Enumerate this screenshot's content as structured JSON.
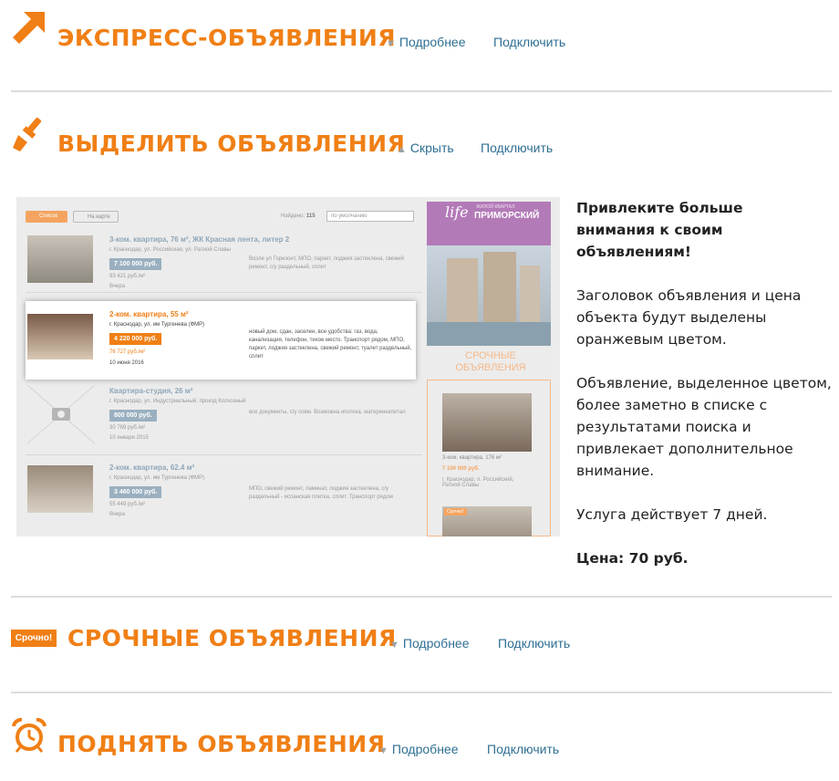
{
  "sections": [
    {
      "title": "ЭКСПРЕСС-ОБЪЯВЛЕНИЯ",
      "toggle": "Подробнее",
      "connect": "Подключить",
      "icon": "arrow-up-right-icon"
    },
    {
      "title": "ВЫДЕЛИТЬ ОБЪЯВЛЕНИЯ",
      "toggle": "Скрыть",
      "connect": "Подключить",
      "icon": "paintbrush-icon"
    },
    {
      "title": "СРОЧНЫЕ ОБЪЯВЛЕНИЯ",
      "toggle": "Подробнее",
      "connect": "Подключить",
      "icon": "urgent-badge-icon",
      "badge": "Срочно!"
    },
    {
      "title": "ПОДНЯТЬ ОБЪЯВЛЕНИЯ",
      "toggle": "Подробнее",
      "connect": "Подключить",
      "icon": "alarm-clock-icon"
    }
  ],
  "highlight": {
    "heading": "Привлеките больше внимания к своим объявлениям!",
    "p1": "Заголовок объявления и цена объекта будут выделены оранжевым цветом.",
    "p2": "Объявление, выделенное цветом, более заметно в списке с результатами поиска и привлекает дополнительное внимание.",
    "p3": "Услуга действует 7 дней.",
    "price": "Цена: 70 руб."
  },
  "preview": {
    "tab_list": "Список",
    "tab_map": "На карте",
    "found_label": "Найдено:",
    "found_count": "115",
    "sort": "по умолчанию",
    "listings": [
      {
        "title": "3-ком. квартира, 76 м², ЖК Красная лента, литер 2",
        "addr": "г. Краснодар, ул. Российская, ул. Ратной Славы",
        "price": "7 100 000 руб.",
        "per": "93 421 руб./м²",
        "date": "Вчера",
        "desc": "Возле ул Горизонт, МПО, паркет, лоджия застеклена, свежий ремонт, с/у раздельный, сплит"
      },
      {
        "title": "2-ком. квартира, 55 м²",
        "addr": "г. Краснодар, ул. им Тургенева (ФМР)",
        "price": "4 220 000 руб.",
        "per": "76 727 руб./м²",
        "date": "10 июня 2016",
        "desc": "новый дом, сдан, заселен, все удобства: газ, вода, канализация, телефон, тихое место. Транспорт рядом, МПО, паркет, лоджия застеклена, свежий ремонт, туалет раздельный, сплит"
      },
      {
        "title": "Квартира-студия, 26 м²",
        "addr": "г. Краснодар, ул. Индустриальный, проезд Колхозный",
        "price": "800 000 руб.",
        "per": "30 769 руб./м²",
        "date": "10 января 2015",
        "desc": "все документы, с/у совм. Возможна ипотека, материнкапитал"
      },
      {
        "title": "2-ком. квартира, 62.4 м²",
        "addr": "г. Краснодар, ул. им Тургенева (ФМР)",
        "price": "3 460 000 руб.",
        "per": "55 449 руб./м²",
        "date": "Вчера",
        "desc": "МПО, свежий ремонт, ламинат, лоджия застеклена, с/у раздельный - испанская плитка, сплит. Транспорт рядом"
      }
    ],
    "ad_brand": "life",
    "ad_brand_sub": "ЖИЛОЙ КВАРТАЛ",
    "ad_name": "ПРИМОРСКИЙ",
    "side_heading": "СРОЧНЫЕ ОБЪЯВЛЕНИЯ",
    "side_item": {
      "title": "3-ком. квартира, 176 м²",
      "price": "7 100 000 руб.",
      "addr": "г. Краснодар, п. Российский, Ратной Славы"
    },
    "side_badge": "Срочно!"
  }
}
